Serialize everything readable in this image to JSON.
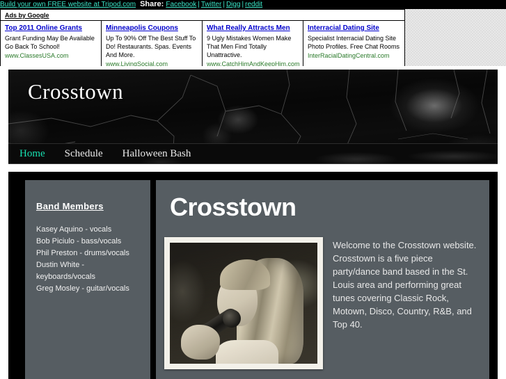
{
  "tripod_bar": {
    "promo_link": "Build your own FREE website at Tripod.com",
    "share_label": "Share:",
    "separator": "|",
    "share_links": [
      "Facebook",
      "Twitter",
      "Digg",
      "reddit"
    ]
  },
  "ads": {
    "header": "Ads by Google",
    "items": [
      {
        "title": "Top 2011 Online Grants",
        "description": "Grant Funding May Be Available Go Back To School!",
        "url": "www.ClassesUSA.com"
      },
      {
        "title": "Minneapolis Coupons",
        "description": "Up To 90% Off The Best Stuff To Do! Restaurants. Spas. Events And More.",
        "url": "www.LivingSocial.com"
      },
      {
        "title": "What Really Attracts Men",
        "description": "9 Ugly Mistakes Women Make That Men Find Totally Unattractive.",
        "url": "www.CatchHimAndKeepHim.com"
      },
      {
        "title": "Interracial Dating Site",
        "description": "Specialist Interracial Dating Site Photo Profiles. Free Chat Rooms",
        "url": "InterRacialDatingCentral.com"
      }
    ]
  },
  "site": {
    "banner_title": "Crosstown",
    "nav": [
      {
        "label": "Home",
        "active": true
      },
      {
        "label": "Schedule",
        "active": false
      },
      {
        "label": "Halloween Bash",
        "active": false
      }
    ],
    "sidebar": {
      "title": "Band Members",
      "members": [
        "Kasey Aquino - vocals",
        "Bob Piciulo - bass/vocals",
        "Phil Preston - drums/vocals",
        "Dustin White - keyboards/vocals",
        "Greg Mosley - guitar/vocals"
      ]
    },
    "main": {
      "title": "Crosstown",
      "photo_alt": "singer-photo",
      "welcome_text": "Welcome to the Crosstown website. Crosstown is a five piece party/dance band based in the St. Louis area and performing great tunes covering Classic Rock, Motown, Disco, Country, R&B, and Top 40."
    }
  },
  "colors": {
    "panel": "#565d62",
    "nav_active": "#17e0b0",
    "tripod_link": "#3ae6c8",
    "ad_title": "#0000cc",
    "ad_url": "#2a7a2a"
  }
}
